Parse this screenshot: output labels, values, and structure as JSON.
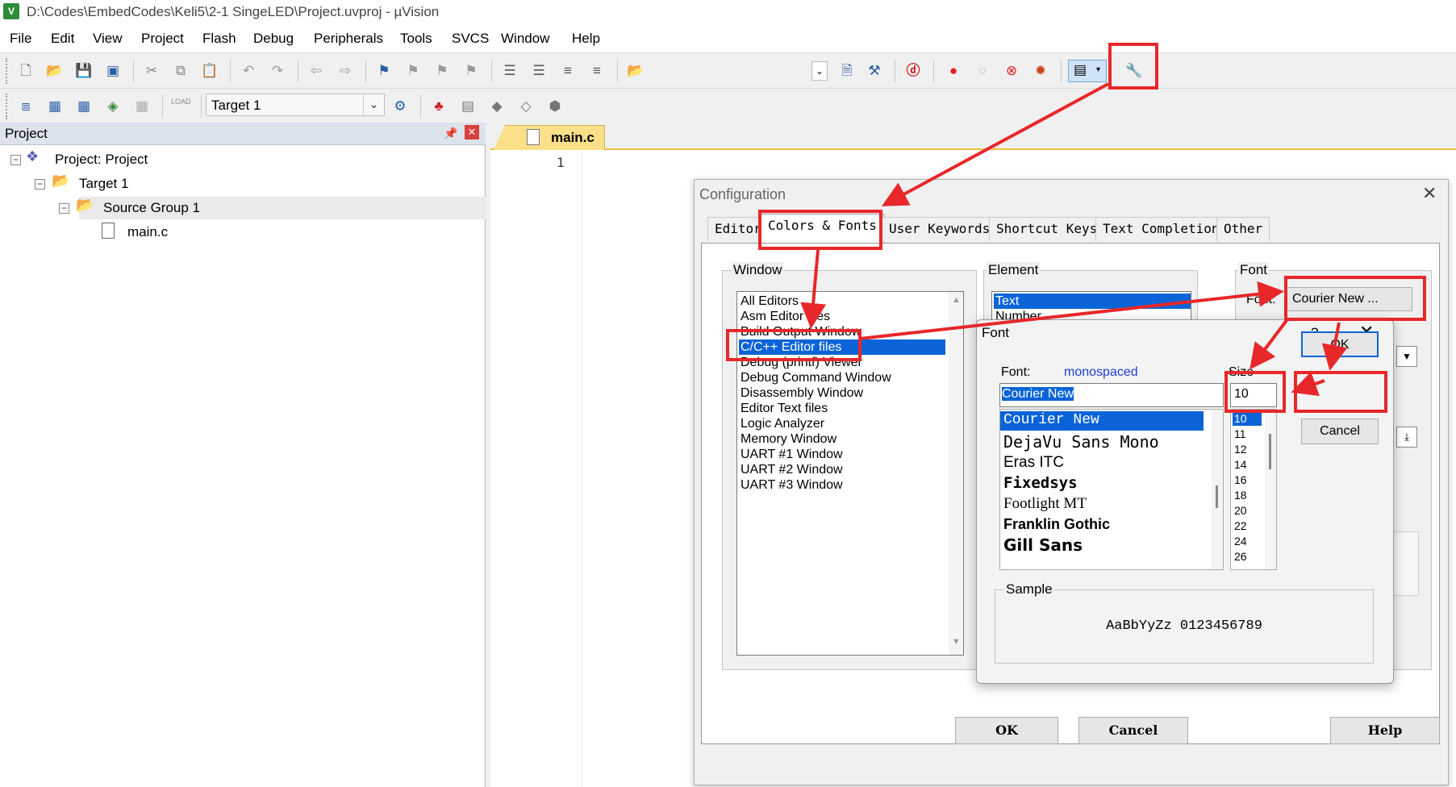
{
  "title_bar": {
    "app_icon": "V",
    "title": "D:\\Codes\\EmbedCodes\\Keli5\\2-1 SingeLED\\Project.uvproj - µVision"
  },
  "menu": [
    "File",
    "Edit",
    "View",
    "Project",
    "Flash",
    "Debug",
    "Peripherals",
    "Tools",
    "SVCS",
    "Window",
    "Help"
  ],
  "toolbar2": {
    "target": "Target 1",
    "load_icon_text": "LOAD"
  },
  "project_panel": {
    "title": "Project",
    "tree": {
      "root": "Project: Project",
      "target": "Target 1",
      "group": "Source Group 1",
      "file": "main.c"
    }
  },
  "editor": {
    "tab": "main.c",
    "line_number": "1"
  },
  "config_dialog": {
    "title": "Configuration",
    "tabs": [
      "Editor",
      "Colors & Fonts",
      "User Keywords",
      "Shortcut Keys",
      "Text Completion",
      "Other"
    ],
    "active_tab": "Colors & Fonts",
    "window_group": "Window",
    "window_list": [
      "All Editors",
      "Asm Editor files",
      "Build Output Window",
      "C/C++ Editor files",
      "Debug (printf) Viewer",
      "Debug Command Window",
      "Disassembly Window",
      "Editor Text files",
      "Logic Analyzer",
      "Memory Window",
      "UART #1 Window",
      "UART #2 Window",
      "UART #3 Window"
    ],
    "selected_window": "C/C++ Editor files",
    "element_group": "Element",
    "element_list": [
      "Text",
      "Number"
    ],
    "font_group": "Font",
    "font_label": "Font:",
    "font_button": "Courier New ...",
    "ok": "OK",
    "cancel": "Cancel",
    "help": "Help"
  },
  "font_dialog": {
    "title": "Font",
    "help": "?",
    "font_label": "Font:",
    "font_hint": "monospaced",
    "font_value": "Courier New",
    "size_label": "Size",
    "size_value": "10",
    "fonts": [
      "Courier New",
      "DejaVu Sans Mono",
      "Eras ITC",
      "Fixedsys",
      "Footlight MT",
      "Franklin Gothic",
      "Gill Sans"
    ],
    "sizes": [
      "10",
      "11",
      "12",
      "14",
      "16",
      "18",
      "20",
      "22",
      "24",
      "26"
    ],
    "ok": "OK",
    "cancel": "Cancel",
    "sample_group": "Sample",
    "sample_text": "AaBbYyZz 0123456789"
  },
  "colors": {
    "annotation_red": "#e8272a",
    "selection_blue": "#0a64d8",
    "tab_yellow": "#fbe08a"
  }
}
